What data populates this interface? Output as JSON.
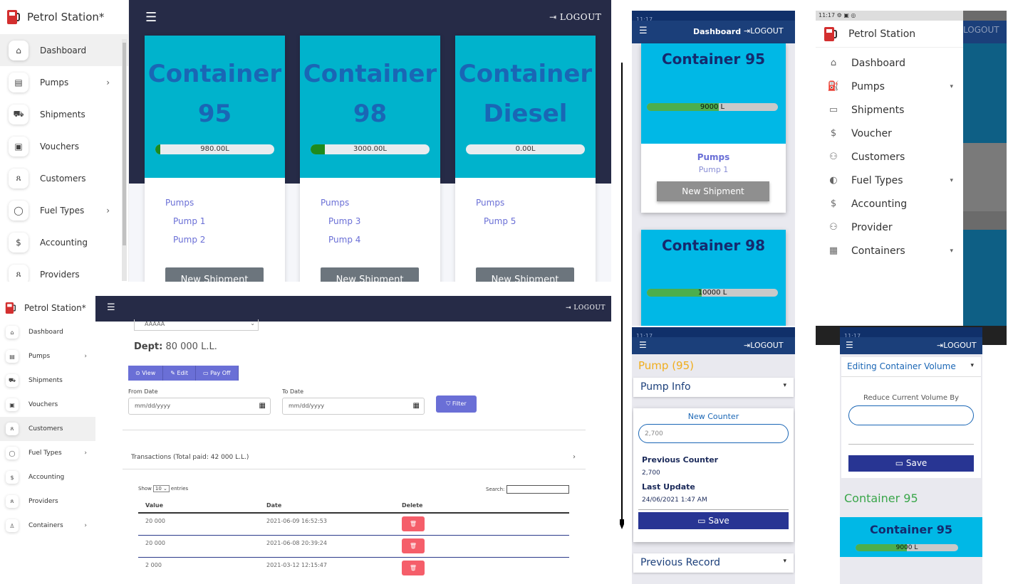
{
  "app": {
    "brand": "Petrol Station*",
    "logout": "LOGOUT"
  },
  "sidebar1": [
    {
      "label": "Dashboard",
      "icon": "⌂",
      "name": "home-icon",
      "chev": false,
      "active": true
    },
    {
      "label": "Pumps",
      "icon": "▤",
      "name": "pump-icon",
      "chev": true
    },
    {
      "label": "Shipments",
      "icon": "⛟",
      "name": "truck-icon",
      "chev": false
    },
    {
      "label": "Vouchers",
      "icon": "▣",
      "name": "voucher-icon",
      "chev": false
    },
    {
      "label": "Customers",
      "icon": "ጸ",
      "name": "users-icon",
      "chev": false
    },
    {
      "label": "Fuel Types",
      "icon": "◯",
      "name": "drop-icon",
      "chev": true
    },
    {
      "label": "Accounting",
      "icon": "$",
      "name": "dollar-icon",
      "chev": false
    },
    {
      "label": "Providers",
      "icon": "ጸ",
      "name": "providers-icon",
      "chev": false
    }
  ],
  "containers": [
    {
      "title_l1": "Container",
      "title_l2": "95",
      "volume": "980.00L",
      "fill": 0.04,
      "pumps_label": "Pumps",
      "pumps": [
        "Pump 1",
        "Pump 2"
      ],
      "button": "New Shipment"
    },
    {
      "title_l1": "Container",
      "title_l2": "98",
      "volume": "3000.00L",
      "fill": 0.12,
      "pumps_label": "Pumps",
      "pumps": [
        "Pump 3",
        "Pump 4"
      ],
      "button": "New Shipment"
    },
    {
      "title_l1": "Container",
      "title_l2": "Diesel",
      "volume": "0.00L",
      "fill": 0.0,
      "pumps_label": "Pumps",
      "pumps": [
        "Pump 5"
      ],
      "button": "New Shipment"
    }
  ],
  "sidebar2": [
    {
      "label": "Dashboard",
      "icon": "⌂",
      "name": "home-icon",
      "chev": false
    },
    {
      "label": "Pumps",
      "icon": "▤",
      "name": "pump-icon",
      "chev": true
    },
    {
      "label": "Shipments",
      "icon": "⛟",
      "name": "truck-icon",
      "chev": false
    },
    {
      "label": "Vouchers",
      "icon": "▣",
      "name": "voucher-icon",
      "chev": false
    },
    {
      "label": "Customers",
      "icon": "ጸ",
      "name": "users-icon",
      "chev": false,
      "active": true
    },
    {
      "label": "Fuel Types",
      "icon": "◯",
      "name": "drop-icon",
      "chev": true
    },
    {
      "label": "Accounting",
      "icon": "$",
      "name": "dollar-icon",
      "chev": false
    },
    {
      "label": "Providers",
      "icon": "ጸ",
      "name": "providers-icon",
      "chev": false
    },
    {
      "label": "Containers",
      "icon": "♙",
      "name": "container-icon",
      "chev": true
    }
  ],
  "customer": {
    "select_value": "AAAAA",
    "dept_label": "Dept:",
    "dept_value": "80 000 L.L.",
    "btn_view": "⊙ View",
    "btn_edit": "✎ Edit",
    "btn_payoff": "▭ Pay Off",
    "from_label": "From Date",
    "to_label": "To Date",
    "date_placeholder": "mm/dd/yyyy",
    "filter": "⛉ Filter",
    "transactions": "Transactions (Total paid: 42 000 L.L.)",
    "show": "Show",
    "show_value": "10",
    "entries": "entries",
    "search": "Search:",
    "cols": [
      "Value",
      "Date",
      "Delete"
    ],
    "rows": [
      {
        "value": "20 000",
        "date": "2021-06-09 16:52:53"
      },
      {
        "value": "20 000",
        "date": "2021-06-08 20:39:24"
      },
      {
        "value": "2 000",
        "date": "2021-03-12 12:15:47"
      }
    ]
  },
  "mobile1": {
    "header_title": "Dashboard",
    "logout": "LOGOUT",
    "c95_title": "Container 95",
    "c95_volume": "9000 L",
    "c95_fill": 0.55,
    "pumps_label": "Pumps",
    "pump": "Pump 1",
    "button": "New Shipment",
    "c98_title": "Container 98",
    "c98_volume": "10000 L",
    "c98_fill": 0.42
  },
  "mobile2": {
    "time": "11:17",
    "brand": "Petrol Station",
    "logout": "LOGOUT",
    "items": [
      {
        "label": "Dashboard",
        "icon": "⌂",
        "name": "home-icon",
        "chev": false
      },
      {
        "label": "Pumps",
        "icon": "⛽",
        "name": "pump-icon",
        "chev": true
      },
      {
        "label": "Shipments",
        "icon": "▭",
        "name": "bus-icon",
        "chev": false
      },
      {
        "label": "Voucher",
        "icon": "$",
        "name": "voucher-icon",
        "chev": false
      },
      {
        "label": "Customers",
        "icon": "⚇",
        "name": "customers-icon",
        "chev": false
      },
      {
        "label": "Fuel Types",
        "icon": "◐",
        "name": "fuel-icon",
        "chev": true
      },
      {
        "label": "Accounting",
        "icon": "$",
        "name": "accounting-icon",
        "chev": false
      },
      {
        "label": "Provider",
        "icon": "⚇",
        "name": "provider-icon",
        "chev": false
      },
      {
        "label": "Containers",
        "icon": "▦",
        "name": "containers-icon",
        "chev": true
      }
    ]
  },
  "mobile3": {
    "logout": "LOGOUT",
    "pump_title": "Pump (95)",
    "pump_info": "Pump Info",
    "new_counter": "New Counter",
    "counter_value": "2,700",
    "prev_counter_label": "Previous Counter",
    "prev_counter": "2,700",
    "last_update_label": "Last Update",
    "last_update": "24/06/2021 1:47 AM",
    "save": "Save",
    "previous_record": "Previous Record"
  },
  "mobile4": {
    "logout": "LOGOUT",
    "section": "Editing Container Volume",
    "reduce_label": "Reduce Current Volume By",
    "save": "Save",
    "container_label": "Container 95",
    "card_title": "Container 95",
    "volume": "9000 L",
    "fill": 0.5
  }
}
